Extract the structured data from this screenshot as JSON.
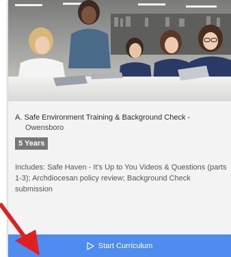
{
  "course_card": {
    "title": "A. Safe Environment Training & Background Check -",
    "location": "Owensboro",
    "duration_badge": "5 Years",
    "description": "Includes: Safe Haven - It's Up to You Videos & Questions (parts 1-3); Archdiocesan policy review; Background Check submission",
    "start_button_label": "Start Curriculum",
    "start_button_icon": "play-outline-icon",
    "colors": {
      "button": "#4f8cf0",
      "badge": "#777777",
      "annotation_arrow": "#e02020"
    }
  }
}
